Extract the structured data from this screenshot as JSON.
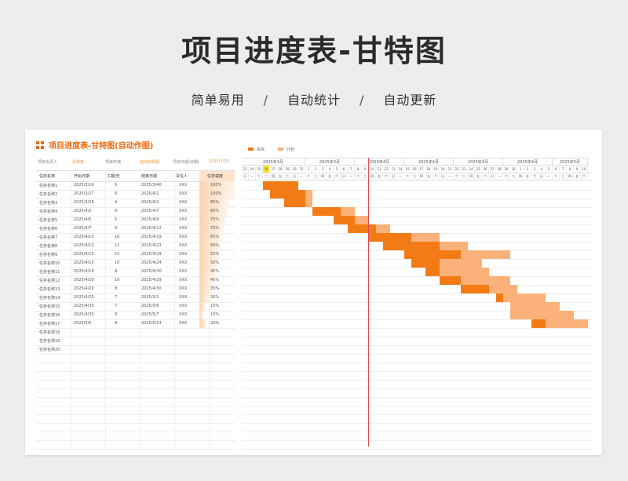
{
  "page": {
    "title": "项目进度表-甘特图",
    "sub1": "简单易用",
    "sub2": "自动统计",
    "sub3": "自动更新",
    "sep": "/"
  },
  "sheet": {
    "title": "项目进度表-甘特图(自动作图)",
    "info": {
      "l1": "项目负责人",
      "v1": "张某某",
      "l2": "项目终端",
      "v2": "自动绘制图",
      "l3": "项目日期(日期)",
      "v3": "2025/3/26"
    },
    "headers": [
      "任务名称",
      "开始日期",
      "工期/天",
      "结束日期",
      "责任人",
      "任务进度"
    ]
  },
  "tasks": [
    {
      "name": "任务名称1",
      "start": "2025/3/16",
      "days": "5",
      "end": "2025/3/40",
      "owner": "XXX",
      "pct": "100%",
      "p": 1.0
    },
    {
      "name": "任务名称2",
      "start": "2025/3/27",
      "days": "6",
      "end": "2025/4/1",
      "owner": "XXX",
      "pct": "100%",
      "p": 1.0
    },
    {
      "name": "任务名称3",
      "start": "2025/3/29",
      "days": "4",
      "end": "2025/4/2",
      "owner": "XXX",
      "pct": "85%",
      "p": 0.85
    },
    {
      "name": "任务名称4",
      "start": "2025/4/2",
      "days": "6",
      "end": "2025/4/7",
      "owner": "XXX",
      "pct": "80%",
      "p": 0.8
    },
    {
      "name": "任务名称5",
      "start": "2025/4/5",
      "days": "5",
      "end": "2025/4/9",
      "owner": "XXX",
      "pct": "75%",
      "p": 0.75
    },
    {
      "name": "任务名称6",
      "start": "2025/4/7",
      "days": "6",
      "end": "2025/4/12",
      "owner": "XXX",
      "pct": "70%",
      "p": 0.7
    },
    {
      "name": "任务名称7",
      "start": "2025/4/10",
      "days": "10",
      "end": "2025/4/19",
      "owner": "XXX",
      "pct": "65%",
      "p": 0.65
    },
    {
      "name": "任务名称8",
      "start": "2025/4/12",
      "days": "12",
      "end": "2025/4/23",
      "owner": "XXX",
      "pct": "60%",
      "p": 0.6
    },
    {
      "name": "任务名称9",
      "start": "2025/4/15",
      "days": "15",
      "end": "2025/4/29",
      "owner": "XXX",
      "pct": "55%",
      "p": 0.55
    },
    {
      "name": "任务名称10",
      "start": "2025/4/15",
      "days": "10",
      "end": "2025/4/24",
      "owner": "XXX",
      "pct": "50%",
      "p": 0.5
    },
    {
      "name": "任务名称11",
      "start": "2025/4/16",
      "days": "9",
      "end": "2025/4/30",
      "owner": "XXX",
      "pct": "45%",
      "p": 0.45
    },
    {
      "name": "任务名称12",
      "start": "2025/4/20",
      "days": "10",
      "end": "2025/4/29",
      "owner": "XXX",
      "pct": "40%",
      "p": 0.4
    },
    {
      "name": "任务名称13",
      "start": "2025/4/20",
      "days": "8",
      "end": "2025/4/30",
      "owner": "XXX",
      "pct": "35%",
      "p": 0.35
    },
    {
      "name": "任务名称14",
      "start": "2025/4/25",
      "days": "7",
      "end": "2025/5/1",
      "owner": "XXX",
      "pct": "30%",
      "p": 0.3
    },
    {
      "name": "任务名称15",
      "start": "2025/4/30",
      "days": "7",
      "end": "2025/5/6",
      "owner": "XXX",
      "pct": "15%",
      "p": 0.15
    },
    {
      "name": "任务名称16",
      "start": "2025/4/30",
      "days": "8",
      "end": "2025/5/7",
      "owner": "XXX",
      "pct": "10%",
      "p": 0.1
    },
    {
      "name": "任务名称17",
      "start": "2025/5/5",
      "days": "8",
      "end": "2025/5/14",
      "owner": "XXX",
      "pct": "20%",
      "p": 0.2
    },
    {
      "name": "任务名称18"
    },
    {
      "name": "任务名称19"
    },
    {
      "name": "任务名称20"
    }
  ],
  "gantt": {
    "legend": {
      "actual": "实际",
      "plan": "计划",
      "actual_color": "#f37b15",
      "plan_color": "#fbb27a"
    },
    "months": [
      "2025年3月",
      "2025年3月",
      "2025年4月",
      "2025年4月",
      "2025年4月",
      "2025年4月",
      "2025年5月"
    ],
    "days": [
      "23",
      "24",
      "25",
      "26",
      "27",
      "28",
      "29",
      "30",
      "31",
      "1",
      "2",
      "3",
      "4",
      "5",
      "6",
      "7",
      "8",
      "9",
      "10",
      "11",
      "12",
      "13",
      "14",
      "15",
      "16",
      "17",
      "18",
      "19",
      "20",
      "21",
      "22",
      "23",
      "24",
      "25",
      "26",
      "27",
      "28",
      "29",
      "30",
      "1",
      "2",
      "3",
      "4",
      "5",
      "6",
      "7",
      "8",
      "9",
      "10"
    ],
    "weekdays": [
      "日",
      "一",
      "二",
      "三",
      "四",
      "五",
      "六",
      "日",
      "一",
      "二",
      "三",
      "四",
      "五",
      "六",
      "日",
      "一",
      "二",
      "三",
      "四",
      "五",
      "六",
      "日",
      "一",
      "二",
      "三",
      "四",
      "五",
      "六",
      "日",
      "一",
      "二",
      "三",
      "四",
      "五",
      "六",
      "日",
      "一",
      "二",
      "三",
      "四",
      "五",
      "六",
      "日",
      "一",
      "二",
      "三",
      "四",
      "五",
      "六"
    ],
    "today_index": 3,
    "today_line_index": 18,
    "bars": [
      {
        "s": 3,
        "d": 5,
        "a": 5
      },
      {
        "s": 4,
        "d": 6,
        "a": 5
      },
      {
        "s": 6,
        "d": 4,
        "a": 3
      },
      {
        "s": 10,
        "d": 6,
        "a": 4
      },
      {
        "s": 13,
        "d": 5,
        "a": 3
      },
      {
        "s": 15,
        "d": 6,
        "a": 4
      },
      {
        "s": 18,
        "d": 10,
        "a": 6
      },
      {
        "s": 20,
        "d": 12,
        "a": 8
      },
      {
        "s": 23,
        "d": 15,
        "a": 8
      },
      {
        "s": 24,
        "d": 10,
        "a": 4
      },
      {
        "s": 26,
        "d": 9,
        "a": 2
      },
      {
        "s": 28,
        "d": 10,
        "a": 3
      },
      {
        "s": 31,
        "d": 8,
        "a": 4
      },
      {
        "s": 36,
        "d": 7,
        "a": 1
      },
      {
        "s": 38,
        "d": 7,
        "a": 0
      },
      {
        "s": 38,
        "d": 9,
        "a": 0
      },
      {
        "s": 41,
        "d": 8,
        "a": 2
      }
    ]
  }
}
